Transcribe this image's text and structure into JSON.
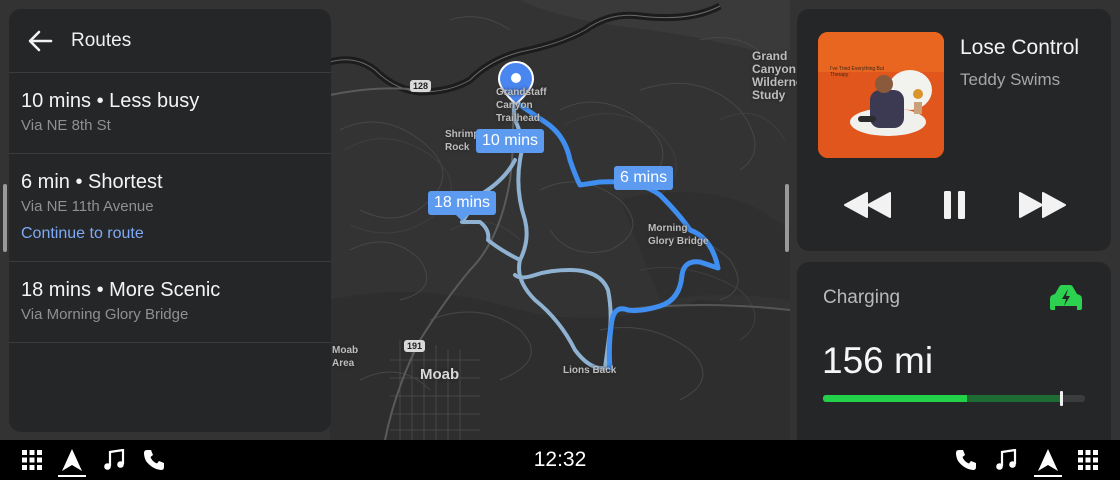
{
  "map": {
    "labels": {
      "moab": "Moab",
      "lions_back": "Lions Back",
      "morning_glory_bridge": "Morning\nGlory Bridge",
      "grand_canyon_wilderness_study": "Grand\nCanyon\nWilderness\nStudy",
      "grandstaff_canyon_trailhead": "Grandstaff\nCanyon\nTrailhead",
      "shrimp_rock": "Shrimp\nRock",
      "moab_area": "Moab\nArea",
      "shield_128": "128",
      "shield_191": "191"
    },
    "route_chips": {
      "chip_10": "10 mins",
      "chip_6": "6 mins",
      "chip_18": "18 mins"
    },
    "colors": {
      "active_route": "#3f8ef0",
      "alt_route": "#8fb2d2",
      "pin": "#4a86f0"
    }
  },
  "routes_panel": {
    "title": "Routes",
    "back_icon": "arrow-left-icon",
    "items": [
      {
        "title": "10 mins • Less busy",
        "subtitle": "Via NE 8th St"
      },
      {
        "title": "6 min • Shortest",
        "subtitle": "Via NE 11th Avenue",
        "action": "Continue to route"
      },
      {
        "title": "18 mins • More Scenic",
        "subtitle": "Via Morning Glory Bridge"
      }
    ]
  },
  "media": {
    "title": "Lose Control",
    "artist": "Teddy Swims",
    "album_caption": "I've Tried Everything But Therapy",
    "controls": [
      "rewind-icon",
      "pause-icon",
      "fast-forward-icon"
    ]
  },
  "charging": {
    "label": "Charging",
    "range": "156 mi",
    "level_fraction": 0.55,
    "target_fraction": 0.91,
    "colors": {
      "fill": "#22d04a",
      "track_target": "#1e6b34",
      "icon": "#2bd14f"
    }
  },
  "bottom_bar": {
    "clock": "12:32",
    "left_icons": [
      "grid-icon",
      "navigation-icon",
      "music-icon",
      "phone-icon"
    ],
    "right_icons": [
      "phone-icon",
      "music-icon",
      "navigation-icon",
      "grid-icon"
    ]
  }
}
